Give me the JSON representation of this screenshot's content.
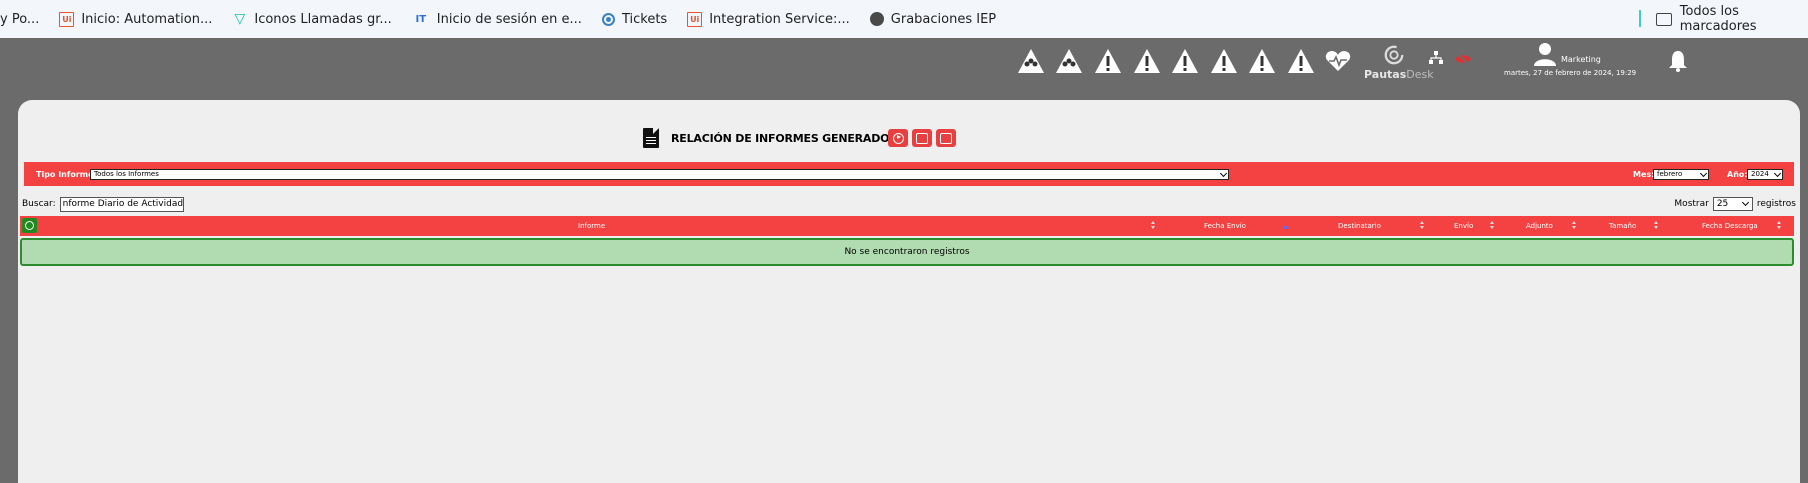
{
  "bookmarks": {
    "items": [
      {
        "label": "y Po...",
        "icon": "none"
      },
      {
        "label": "Inicio: Automation...",
        "icon": "uipath-icon"
      },
      {
        "label": "Iconos Llamadas gr...",
        "icon": "v-logo-icon"
      },
      {
        "label": "Inicio de sesión en e...",
        "icon": "it-logo-icon"
      },
      {
        "label": "Tickets",
        "icon": "ticket-icon"
      },
      {
        "label": "Integration Service:...",
        "icon": "uipath-icon"
      },
      {
        "label": "Grabaciones IEP",
        "icon": "globe-icon"
      }
    ],
    "all_bookmarks": "Todos los marcadores"
  },
  "header": {
    "logo_main": "Pautas",
    "logo_desk": "Desk",
    "user_name": "Marketing",
    "date": "martes, 27 de febrero de 2024, 19:29",
    "colors": {
      "header_bg": "#6b6b6b",
      "icon_white": "#ffffff",
      "alert_red": "#e03030"
    }
  },
  "main": {
    "title": "RELACIÓN DE INFORMES GENERADOS",
    "filter": {
      "tipo_label": "Tipo Informe:",
      "tipo_value": "Todos los Informes",
      "mes_label": "Mes:",
      "mes_value": "febrero",
      "anio_label": "Año:",
      "anio_value": "2024"
    },
    "search_label": "Buscar:",
    "search_value": "nforme Diario de Actividad",
    "show_label": "Mostrar",
    "show_value": "25",
    "show_suffix": "registros",
    "columns": [
      "Informe",
      "Fecha Envío",
      "Destinatario",
      "Envío",
      "Adjunto",
      "Tamaño",
      "Fecha Descarga"
    ],
    "empty_message": "No se encontraron registros",
    "colors": {
      "accent_red": "#f44242",
      "empty_green": "#b1dcb1",
      "check_green": "#1f8b1f"
    }
  }
}
